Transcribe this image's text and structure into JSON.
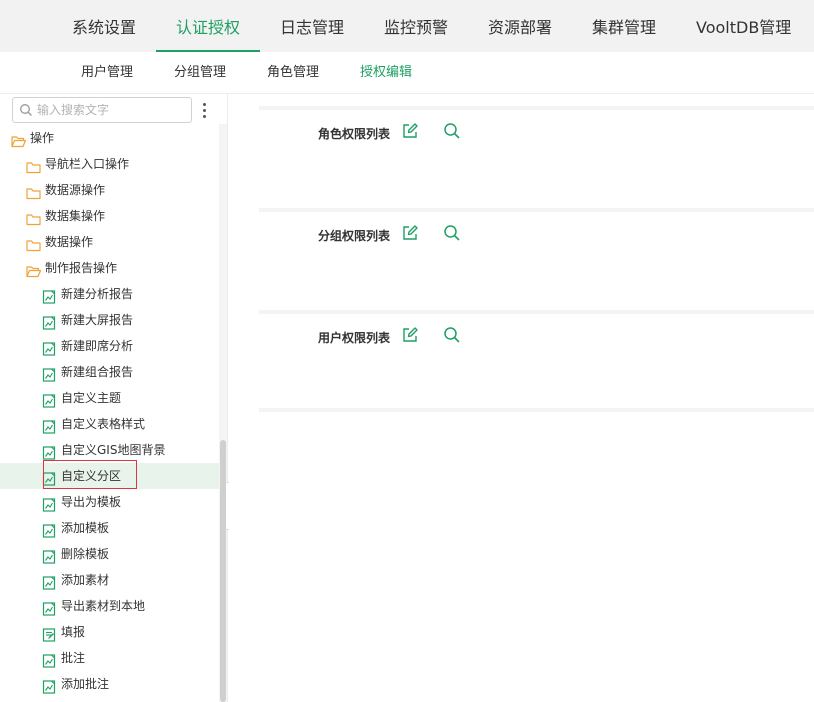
{
  "top_nav": {
    "items": [
      {
        "label": "系统设置"
      },
      {
        "label": "认证授权"
      },
      {
        "label": "日志管理"
      },
      {
        "label": "监控预警"
      },
      {
        "label": "资源部署"
      },
      {
        "label": "集群管理"
      },
      {
        "label": "VooltDB管理"
      }
    ],
    "active": "认证授权"
  },
  "sub_nav": {
    "items": [
      {
        "label": "用户管理"
      },
      {
        "label": "分组管理"
      },
      {
        "label": "角色管理"
      },
      {
        "label": "授权编辑"
      }
    ],
    "active": "授权编辑"
  },
  "sidebar": {
    "search": {
      "placeholder": "输入搜索文字",
      "value": ""
    },
    "tree": [
      {
        "label": "操作",
        "icon": "folder-open-icon",
        "level": 0
      },
      {
        "label": "导航栏入口操作",
        "icon": "folder-icon",
        "level": 1
      },
      {
        "label": "数据源操作",
        "icon": "folder-icon",
        "level": 1
      },
      {
        "label": "数据集操作",
        "icon": "folder-icon",
        "level": 1
      },
      {
        "label": "数据操作",
        "icon": "folder-icon",
        "level": 1
      },
      {
        "label": "制作报告操作",
        "icon": "folder-open-icon",
        "level": 1
      },
      {
        "label": "新建分析报告",
        "icon": "report-icon",
        "level": 2
      },
      {
        "label": "新建大屏报告",
        "icon": "report-icon",
        "level": 2
      },
      {
        "label": "新建即席分析",
        "icon": "report-icon",
        "level": 2
      },
      {
        "label": "新建组合报告",
        "icon": "report-icon",
        "level": 2
      },
      {
        "label": "自定义主题",
        "icon": "report-icon",
        "level": 2
      },
      {
        "label": "自定义表格样式",
        "icon": "report-icon",
        "level": 2
      },
      {
        "label": "自定义GIS地图背景",
        "icon": "report-icon",
        "level": 2
      },
      {
        "label": "自定义分区",
        "icon": "report-icon",
        "level": 2
      },
      {
        "label": "导出为模板",
        "icon": "report-icon",
        "level": 2
      },
      {
        "label": "添加模板",
        "icon": "report-icon",
        "level": 2
      },
      {
        "label": "删除模板",
        "icon": "report-icon",
        "level": 2
      },
      {
        "label": "添加素材",
        "icon": "report-icon",
        "level": 2
      },
      {
        "label": "导出素材到本地",
        "icon": "report-icon",
        "level": 2
      },
      {
        "label": "填报",
        "icon": "form-icon",
        "level": 2
      },
      {
        "label": "批注",
        "icon": "report-icon",
        "level": 2
      },
      {
        "label": "添加批注",
        "icon": "report-icon",
        "level": 2
      }
    ],
    "selected": "自定义分区"
  },
  "content": {
    "sections": [
      {
        "label": "角色权限列表"
      },
      {
        "label": "分组权限列表"
      },
      {
        "label": "用户权限列表"
      }
    ]
  },
  "colors": {
    "accent": "#1e9f63",
    "folder": "#f0a23a",
    "selected_bg": "#e8f3ec",
    "highlight_border": "#d9363e"
  }
}
